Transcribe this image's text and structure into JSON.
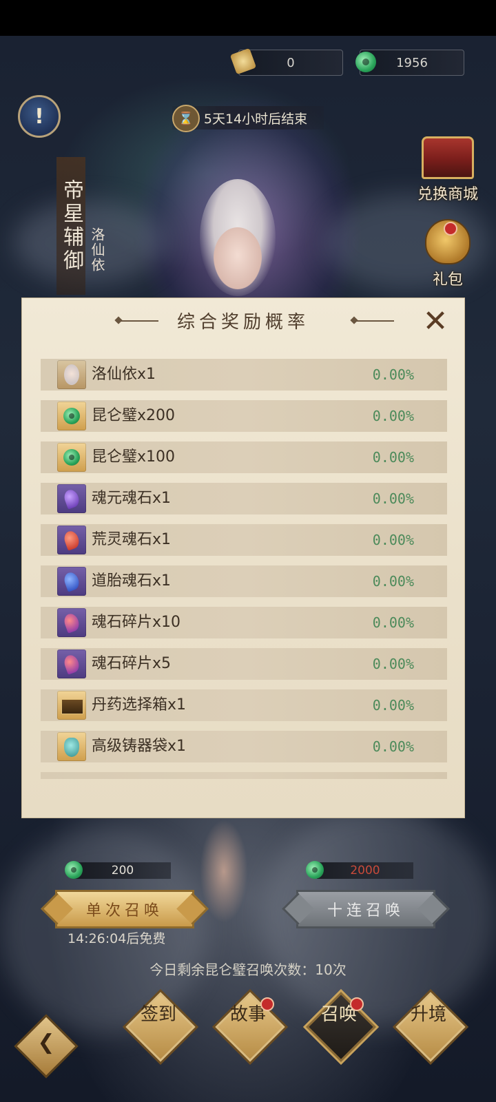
{
  "header": {
    "ticket_count": "0",
    "jade_count": "1956",
    "countdown": "5天14小时后结束"
  },
  "banner": {
    "title": "帝星辅御",
    "character_name": "洛仙依"
  },
  "side_menu": [
    {
      "label": "兑换商城",
      "icon": "treasure-chest-icon"
    },
    {
      "label": "礼包",
      "icon": "gift-bag-icon"
    }
  ],
  "modal": {
    "title": "综合奖励概率",
    "items": [
      {
        "name": "洛仙依x1",
        "rate": "0.00%",
        "icon": "portrait"
      },
      {
        "name": "昆仑璧x200",
        "rate": "0.00%",
        "icon": "jade"
      },
      {
        "name": "昆仑璧x100",
        "rate": "0.00%",
        "icon": "jade"
      },
      {
        "name": "魂元魂石x1",
        "rate": "0.00%",
        "icon": "gem-violet"
      },
      {
        "name": "荒灵魂石x1",
        "rate": "0.00%",
        "icon": "gem-red"
      },
      {
        "name": "道胎魂石x1",
        "rate": "0.00%",
        "icon": "gem-blue"
      },
      {
        "name": "魂石碎片x10",
        "rate": "0.00%",
        "icon": "gem-shard"
      },
      {
        "name": "魂石碎片x5",
        "rate": "0.00%",
        "icon": "gem-shard"
      },
      {
        "name": "丹药选择箱x1",
        "rate": "0.00%",
        "icon": "chest"
      },
      {
        "name": "高级铸器袋x1",
        "rate": "0.00%",
        "icon": "bag"
      }
    ]
  },
  "summon": {
    "single_cost": "200",
    "ten_cost": "2000",
    "single_label": "单次召唤",
    "ten_label": "十连召唤",
    "free_timer": "14:26:04后免费",
    "remaining": "今日剩余昆仑璧召唤次数：10次"
  },
  "bottom_nav": [
    {
      "label": "签到",
      "active": false,
      "badge": false
    },
    {
      "label": "故事",
      "active": false,
      "badge": true
    },
    {
      "label": "召唤",
      "active": true,
      "badge": true
    },
    {
      "label": "升境",
      "active": false,
      "badge": false
    }
  ],
  "colors": {
    "rate_green": "#4c8a5a",
    "modal_bg": "#ebe1cb",
    "row_bg": "#d8cbb3",
    "ten_cost_red": "#c84a3a"
  }
}
